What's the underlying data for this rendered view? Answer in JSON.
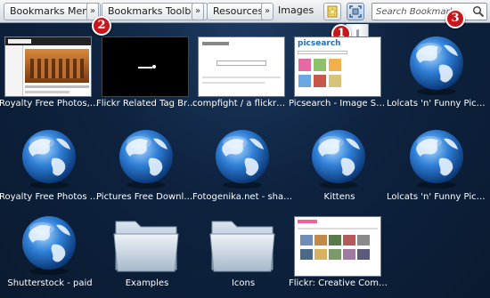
{
  "toolbar": {
    "crumbs": [
      "Bookmarks Menu",
      "Bookmarks Toolbar",
      "Resources",
      "Images"
    ],
    "separator": "»",
    "search_placeholder": "Search Bookmarks",
    "buttons": [
      "add-bookmark-icon",
      "zoom-icon"
    ]
  },
  "callouts": [
    "1",
    "2",
    "3"
  ],
  "items": [
    {
      "label": "Royalty Free Photos, D...",
      "kind": "screenshot-colosseum"
    },
    {
      "label": "Flickr Related Tag Bro...",
      "kind": "screenshot-dark"
    },
    {
      "label": "compfight / a flickr™ s...",
      "kind": "screenshot-light"
    },
    {
      "label": "Picsearch - Image Sear...",
      "kind": "screenshot-picsearch",
      "inner_text": "picsearch"
    },
    {
      "label": "Lolcats 'n' Funny Pictu...",
      "kind": "globe-icon"
    },
    {
      "label": "Royalty Free Photos - ...",
      "kind": "globe-icon"
    },
    {
      "label": "Pictures Free Download",
      "kind": "globe-icon"
    },
    {
      "label": "Fotogenika.net - shari...",
      "kind": "globe-icon"
    },
    {
      "label": "Kittens",
      "kind": "globe-icon"
    },
    {
      "label": "Lolcats 'n' Funny Pictu...",
      "kind": "globe-icon"
    },
    {
      "label": "Shutterstock - paid",
      "kind": "globe-icon"
    },
    {
      "label": "Examples",
      "kind": "folder-icon"
    },
    {
      "label": "Icons",
      "kind": "folder-icon"
    },
    {
      "label": "Flickr: Creative Comm...",
      "kind": "screenshot-flickr"
    }
  ],
  "colors": {
    "accent": "#c8161d",
    "background": "#0e2340"
  }
}
